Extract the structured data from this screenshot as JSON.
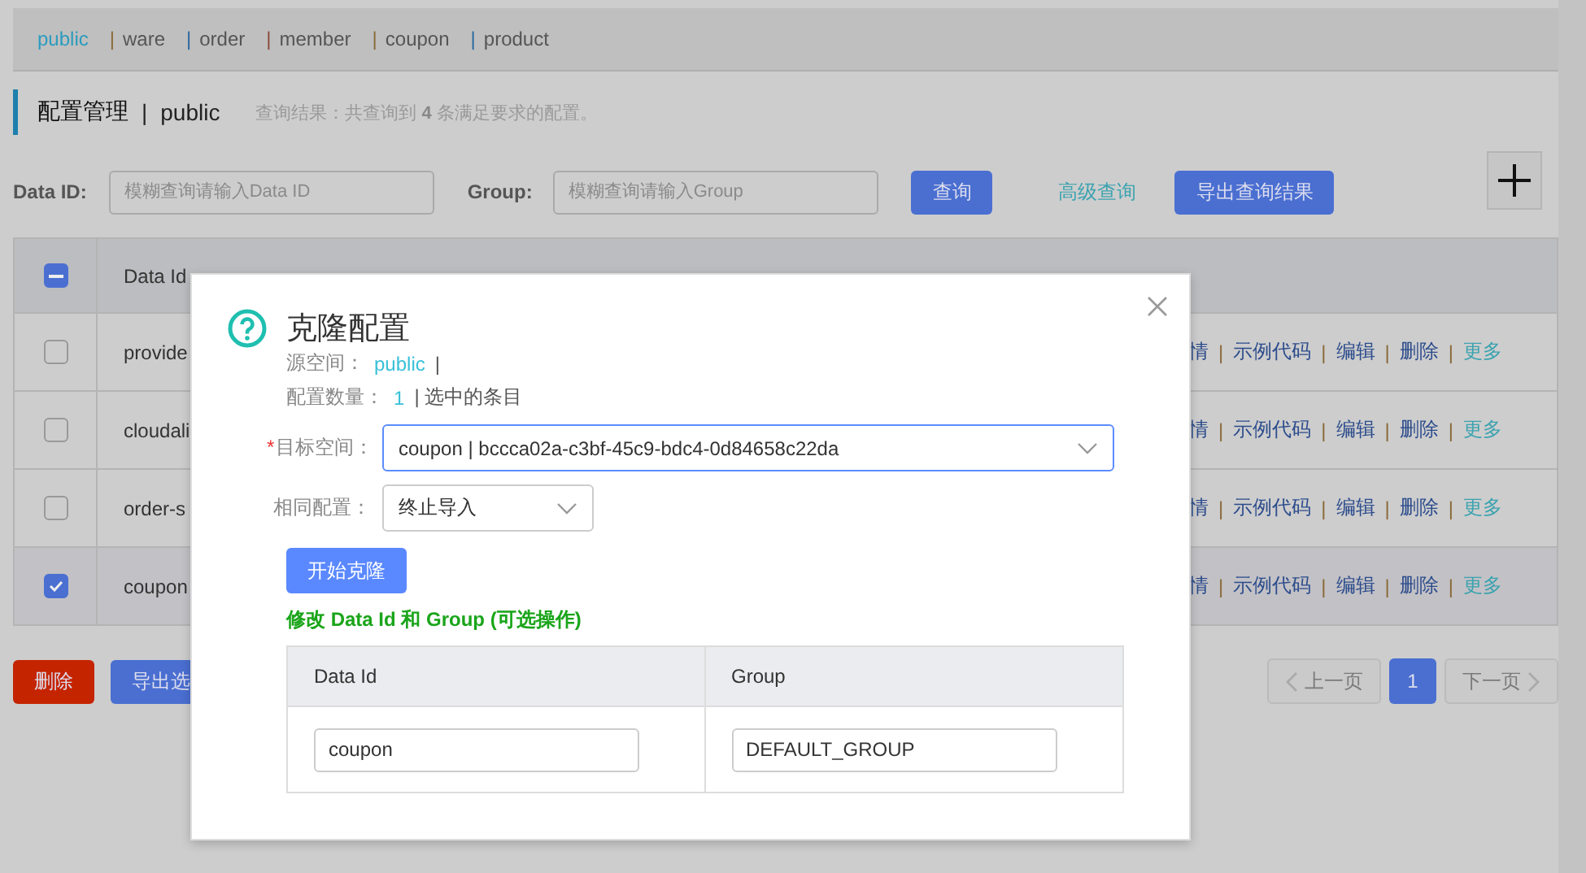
{
  "nav": {
    "separator": "|",
    "tabs": [
      {
        "label": "public",
        "selected": true
      },
      {
        "label": "ware",
        "selected": false
      },
      {
        "label": "order",
        "selected": false
      },
      {
        "label": "member",
        "selected": false
      },
      {
        "label": "coupon",
        "selected": false
      },
      {
        "label": "product",
        "selected": false
      }
    ]
  },
  "page_header": {
    "title": "配置管理",
    "separator": "|",
    "namespace": "public",
    "result_text": "查询结果：共查询到 **4** 条满足要求的配置。"
  },
  "search": {
    "data_id_label": "Data ID:",
    "data_id_placeholder": "模糊查询请输入Data ID",
    "group_label": "Group:",
    "group_placeholder": "模糊查询请输入Group",
    "query_button": "查询",
    "advanced_link": "高级查询",
    "export_button": "导出查询结果"
  },
  "table": {
    "columns": [
      "Data Id"
    ],
    "select_all_indeterminate": true,
    "separator": "|",
    "rows": [
      {
        "data_id": "provide",
        "selected": false,
        "actions": [
          {
            "label": "情",
            "kind": "link"
          },
          {
            "label": "示例代码",
            "kind": "link"
          },
          {
            "label": "编辑",
            "kind": "link"
          },
          {
            "label": "删除",
            "kind": "link"
          },
          {
            "label": "更多",
            "kind": "more"
          }
        ]
      },
      {
        "data_id": "cloudali",
        "selected": false,
        "actions": [
          {
            "label": "情",
            "kind": "link"
          },
          {
            "label": "示例代码",
            "kind": "link"
          },
          {
            "label": "编辑",
            "kind": "link"
          },
          {
            "label": "删除",
            "kind": "link"
          },
          {
            "label": "更多",
            "kind": "more"
          }
        ]
      },
      {
        "data_id": "order-s",
        "selected": false,
        "actions": [
          {
            "label": "情",
            "kind": "link"
          },
          {
            "label": "示例代码",
            "kind": "link"
          },
          {
            "label": "编辑",
            "kind": "link"
          },
          {
            "label": "删除",
            "kind": "link"
          },
          {
            "label": "更多",
            "kind": "more"
          }
        ]
      },
      {
        "data_id": "coupon",
        "selected": true,
        "actions": [
          {
            "label": "情",
            "kind": "link"
          },
          {
            "label": "示例代码",
            "kind": "link"
          },
          {
            "label": "编辑",
            "kind": "link"
          },
          {
            "label": "删除",
            "kind": "link"
          },
          {
            "label": "更多",
            "kind": "more"
          }
        ]
      }
    ]
  },
  "bulk_actions": [
    {
      "label": "删除",
      "kind": "danger"
    },
    {
      "label": "导出选",
      "kind": "primary"
    }
  ],
  "pagination": {
    "prev": {
      "label": "上一页",
      "disabled": true
    },
    "pages": [
      {
        "label": "1",
        "selected": true
      }
    ],
    "next": {
      "label": "下一页",
      "disabled": true
    }
  },
  "dialog": {
    "title": "克隆配置",
    "source_label": "源空间：",
    "source_value": "public",
    "source_suffix": "|",
    "count_label": "配置数量：",
    "count_value": "1",
    "count_suffix": "| 选中的条目",
    "target_label": "目标空间：",
    "required_mark": "*",
    "target_value": "coupon | bccca02a-c3bf-45c9-bdc4-0d84658c22da",
    "same_label": "相同配置：",
    "same_value": "终止导入",
    "start_button": "开始克隆",
    "edit_title": "修改 Data Id 和 Group (可选操作)",
    "edit_columns": [
      "Data Id",
      "Group"
    ],
    "edit_rows": [
      {
        "data_id": "coupon",
        "group": "DEFAULT_GROUP"
      }
    ]
  }
}
